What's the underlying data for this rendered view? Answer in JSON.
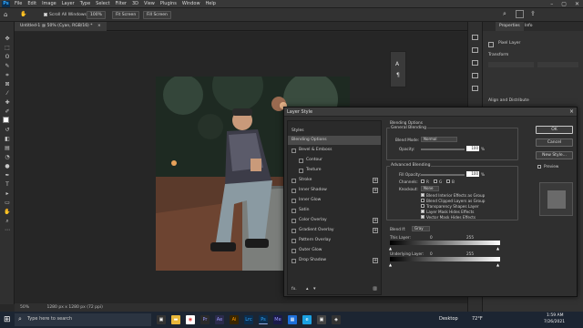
{
  "menubar": {
    "logo": "Ps",
    "items": [
      "File",
      "Edit",
      "Image",
      "Layer",
      "Type",
      "Select",
      "Filter",
      "3D",
      "View",
      "Plugins",
      "Window",
      "Help"
    ],
    "window_controls": [
      "–",
      "▢",
      "✕"
    ]
  },
  "options_bar": {
    "scroll_all": "Scroll All Windows",
    "zoom": "100%",
    "fit_screen": "Fit Screen",
    "fill_screen": "Fill Screen"
  },
  "document": {
    "tab_title": "Untitled-1 @ 50% (Cyan, RGB/16) *",
    "tab_close": "×",
    "status_zoom": "50%",
    "status_info": "1280 px x 1280 px (72 ppi)"
  },
  "context_panel": {
    "icon1": "A",
    "icon2": "¶"
  },
  "properties": {
    "tab_properties": "Properties",
    "tab_info": "Info",
    "pixel_layer": "Pixel Layer",
    "transform": "Transform",
    "align": "Align and Distribute"
  },
  "layer_style": {
    "title": "Layer Style",
    "close": "×",
    "styles_header": "Styles",
    "items": [
      {
        "label": "Blending Options",
        "check": false,
        "plus": false,
        "selected": true,
        "indent": false
      },
      {
        "label": "Bevel & Emboss",
        "check": true,
        "plus": false,
        "selected": false,
        "indent": false
      },
      {
        "label": "Contour",
        "check": true,
        "plus": false,
        "selected": false,
        "indent": true
      },
      {
        "label": "Texture",
        "check": true,
        "plus": false,
        "selected": false,
        "indent": true
      },
      {
        "label": "Stroke",
        "check": true,
        "plus": true,
        "selected": false,
        "indent": false
      },
      {
        "label": "Inner Shadow",
        "check": true,
        "plus": true,
        "selected": false,
        "indent": false
      },
      {
        "label": "Inner Glow",
        "check": true,
        "plus": false,
        "selected": false,
        "indent": false
      },
      {
        "label": "Satin",
        "check": true,
        "plus": false,
        "selected": false,
        "indent": false
      },
      {
        "label": "Color Overlay",
        "check": true,
        "plus": true,
        "selected": false,
        "indent": false
      },
      {
        "label": "Gradient Overlay",
        "check": true,
        "plus": true,
        "selected": false,
        "indent": false
      },
      {
        "label": "Pattern Overlay",
        "check": true,
        "plus": false,
        "selected": false,
        "indent": false
      },
      {
        "label": "Outer Glow",
        "check": true,
        "plus": false,
        "selected": false,
        "indent": false
      },
      {
        "label": "Drop Shadow",
        "check": true,
        "plus": true,
        "selected": false,
        "indent": false
      }
    ],
    "footer_fx": "fx.",
    "blending_options": "Blending Options",
    "general_blending": "General Blending",
    "blend_mode_label": "Blend Mode:",
    "blend_mode_value": "Normal",
    "opacity_label": "Opacity:",
    "opacity_value": "100",
    "percent": "%",
    "advanced_blending": "Advanced Blending",
    "fill_opacity_label": "Fill Opacity:",
    "fill_opacity_value": "100",
    "channels_label": "Channels:",
    "channel_r": "R",
    "channel_g": "G",
    "channel_b": "B",
    "knockout_label": "Knockout:",
    "knockout_value": "None",
    "options": [
      {
        "label": "Blend Interior Effects as Group",
        "checked": false
      },
      {
        "label": "Blend Clipped Layers as Group",
        "checked": true
      },
      {
        "label": "Transparency Shapes Layer",
        "checked": true
      },
      {
        "label": "Layer Mask Hides Effects",
        "checked": false
      },
      {
        "label": "Vector Mask Hides Effects",
        "checked": false
      }
    ],
    "blend_if_label": "Blend If:",
    "blend_if_value": "Gray",
    "this_layer_label": "This Layer:",
    "this_layer_min": "0",
    "this_layer_max": "255",
    "underlying_label": "Underlying Layer:",
    "underlying_min": "0",
    "underlying_max": "255",
    "ok": "OK",
    "cancel": "Cancel",
    "new_style": "New Style...",
    "preview_label": "Preview"
  },
  "taskbar": {
    "search_placeholder": "Type here to search",
    "apps": [
      "Pr",
      "Ae",
      "Ai",
      "Lrc",
      "Ps",
      "Me"
    ],
    "desktop": "Desktop",
    "temperature": "72°F",
    "time": "1:59 AM",
    "date": "7/26/2021"
  },
  "colors": {
    "accent": "#31a8ff",
    "dialog_bg": "#2f2f2f",
    "taskbar": "#1c2532"
  }
}
